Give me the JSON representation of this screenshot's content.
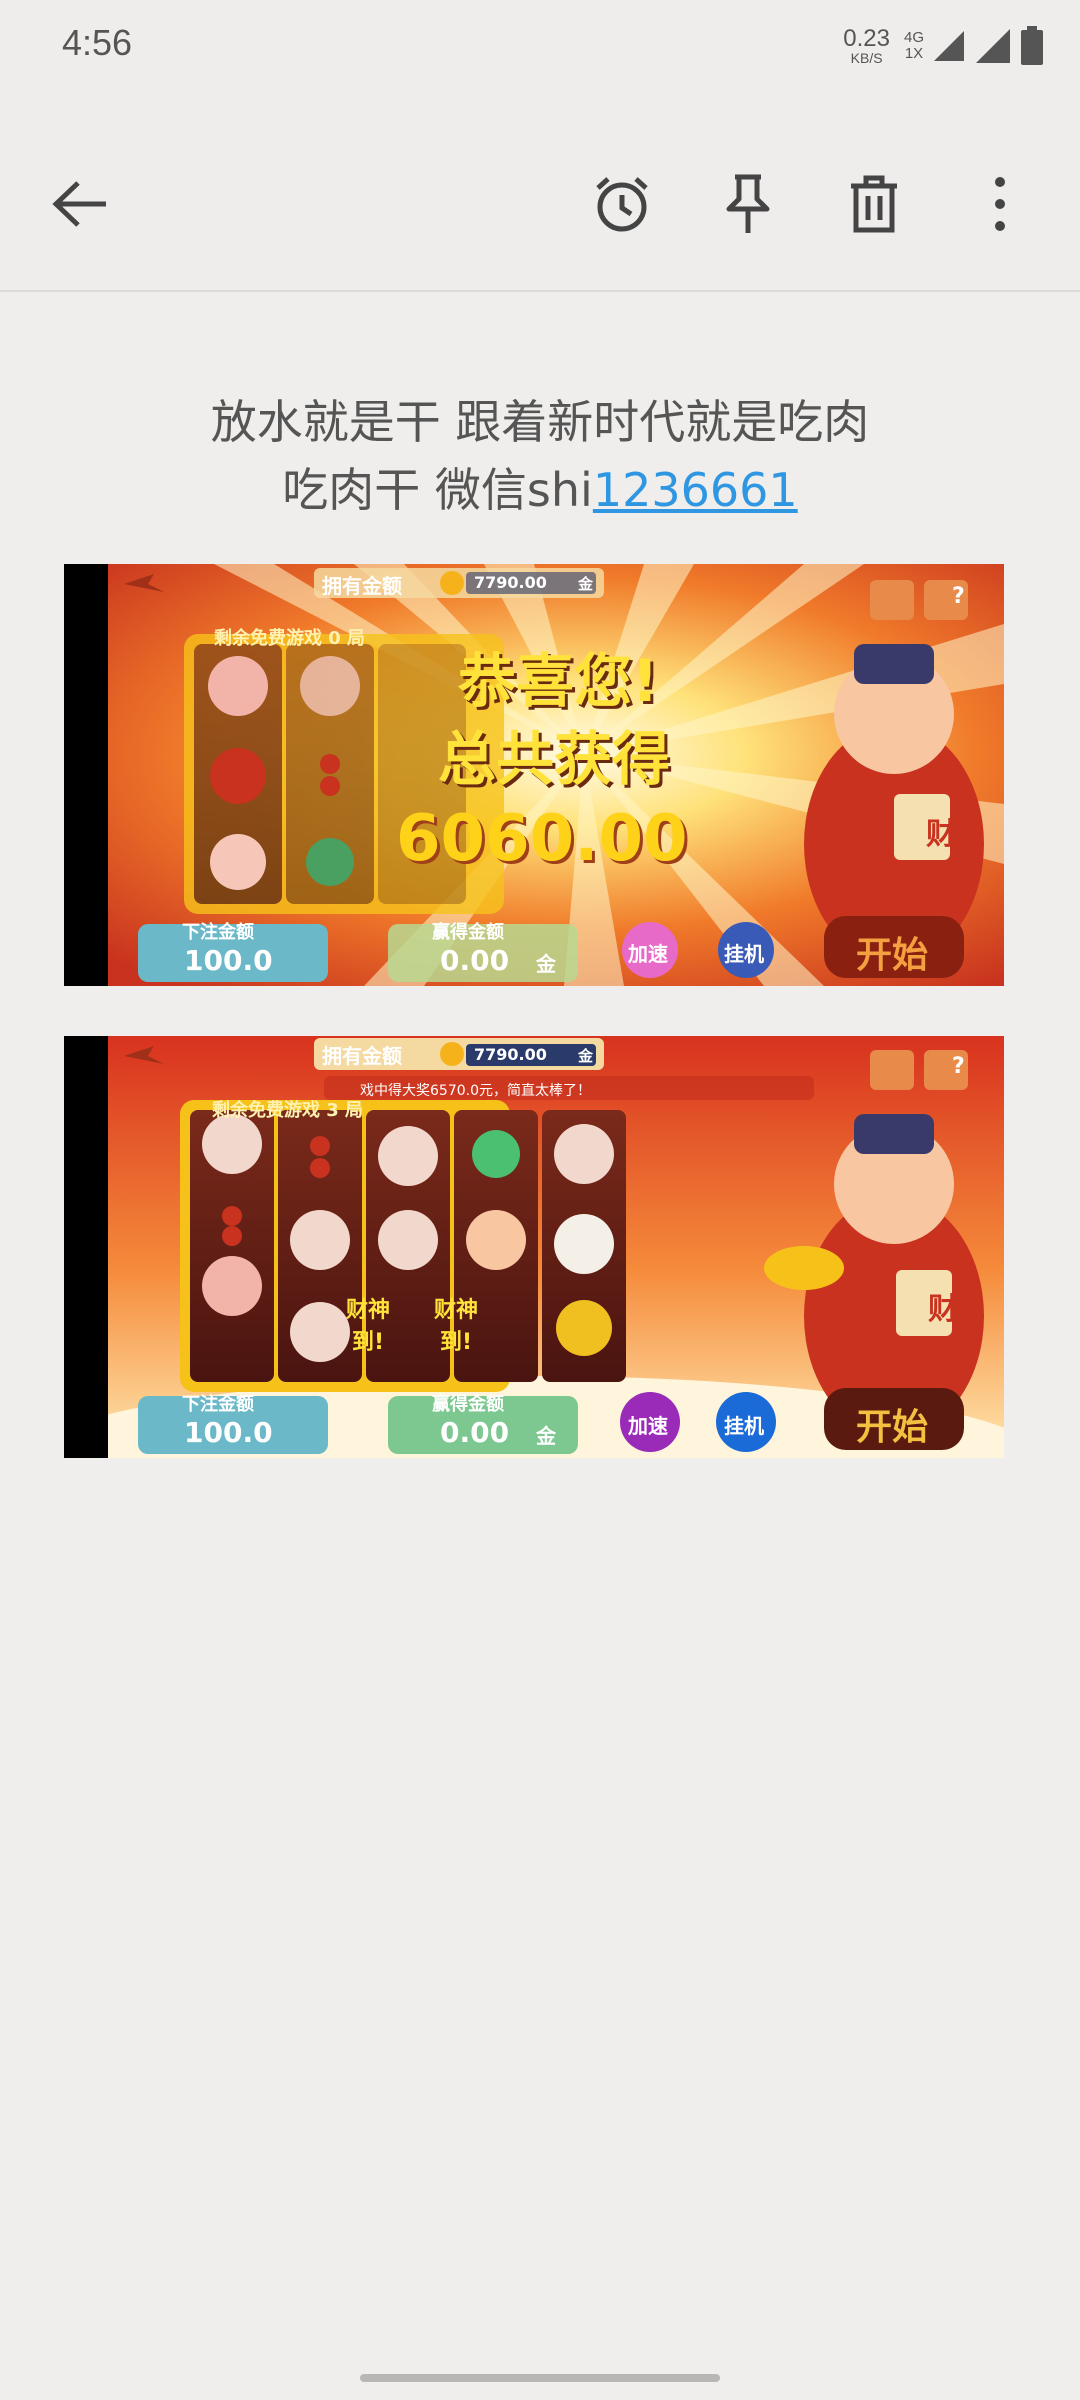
{
  "status_bar": {
    "time": "4:56",
    "net_speed_value": "0.23",
    "net_speed_unit": "KB/S",
    "net_type_top": "4G",
    "net_type_bottom": "1X"
  },
  "toolbar": {
    "icons": [
      "back-arrow-icon",
      "alarm-icon",
      "pin-icon",
      "trash-icon",
      "more-vert-icon"
    ]
  },
  "note": {
    "line1": "放水就是干 跟着新时代就是吃肉",
    "line2_prefix": "吃肉干 微信shi",
    "line2_link": "1236661"
  },
  "game1": {
    "balance_label": "拥有金额",
    "balance_value": "7790.00",
    "currency": "金",
    "free_games_label": "剩余免费游戏 0 局",
    "banner_line1": "恭喜您!",
    "banner_line2": "总共获得",
    "prize_amount": "6060.00",
    "bet_label": "下注金额",
    "bet_value": "100.0",
    "win_label": "赢得金额",
    "win_value": "0.00",
    "speed_button": "加速",
    "auto_button": "挂机",
    "start_button": "开始",
    "help_icon": "?",
    "mascot_sign": "财"
  },
  "game2": {
    "balance_label": "拥有金额",
    "balance_value": "7790.00",
    "currency": "金",
    "ticker": "戏中得大奖6570.0元，简直太棒了！",
    "free_games_label": "剩余免费游戏 3 局",
    "reel_text_1": "财神到!",
    "reel_text_2": "财神到!",
    "bet_label": "下注金额",
    "bet_value": "100.0",
    "win_label": "赢得金额",
    "win_value": "0.00",
    "speed_button": "加速",
    "auto_button": "挂机",
    "start_button": "开始",
    "help_icon": "?",
    "mascot_sign": "财"
  },
  "colors": {
    "background": "#f0eeec",
    "link": "#2f97e2",
    "text": "#555555",
    "game_red": "#c8321e",
    "game_gold": "#f6c21a"
  }
}
